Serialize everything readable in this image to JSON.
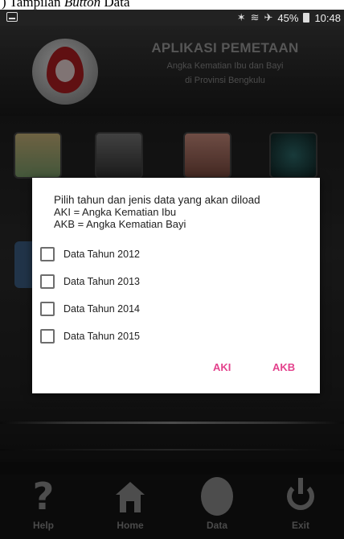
{
  "caption": {
    "prefix": ") Tampilan ",
    "italic": "Button",
    "suffix": " Data"
  },
  "status_bar": {
    "battery": "45%",
    "time": "10:48",
    "icons": [
      "notification-icon",
      "bluetooth-icon",
      "wifi-icon",
      "airplane-icon",
      "battery-icon"
    ]
  },
  "header": {
    "title": "APLIKASI PEMETAAN",
    "subtitle_line1": "Angka Kematian Ibu dan Bayi",
    "subtitle_line2": "di Provinsi Bengkulu"
  },
  "dialog": {
    "message_line1": "Pilih tahun dan jenis data yang akan diload",
    "message_line2": "AKI = Angka Kematian Ibu",
    "message_line3": "AKB = Angka Kematian Bayi",
    "options": [
      {
        "label": "Data Tahun 2012",
        "checked": false
      },
      {
        "label": "Data Tahun 2013",
        "checked": false
      },
      {
        "label": "Data Tahun 2014",
        "checked": false
      },
      {
        "label": "Data Tahun 2015",
        "checked": false
      }
    ],
    "button_aki": "AKI",
    "button_akb": "AKB",
    "accent_color": "#e3418c"
  },
  "bottom_nav": {
    "items": [
      {
        "label": "Help",
        "icon": "question-icon"
      },
      {
        "label": "Home",
        "icon": "home-icon"
      },
      {
        "label": "Data",
        "icon": "data-icon"
      },
      {
        "label": "Exit",
        "icon": "power-icon"
      }
    ]
  }
}
